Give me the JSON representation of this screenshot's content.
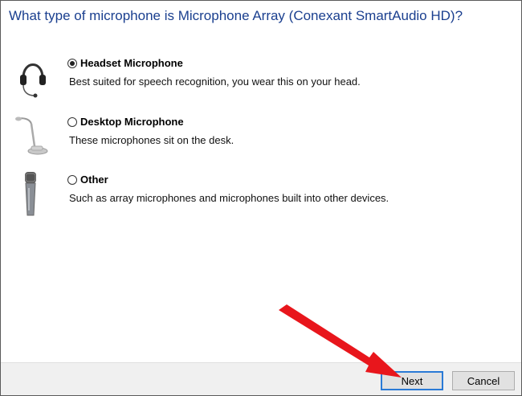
{
  "dialog": {
    "title": "What type of microphone is Microphone Array (Conexant SmartAudio HD)?"
  },
  "options": [
    {
      "label": "Headset Microphone",
      "description": "Best suited for speech recognition, you wear this on your head.",
      "selected": true,
      "icon": "headset-icon"
    },
    {
      "label": "Desktop Microphone",
      "description": "These microphones sit on the desk.",
      "selected": false,
      "icon": "desktop-microphone-icon"
    },
    {
      "label": "Other",
      "description": "Such as array microphones and microphones built into other devices.",
      "selected": false,
      "icon": "handheld-microphone-icon"
    }
  ],
  "buttons": {
    "next_label": "Next",
    "cancel_label": "Cancel"
  },
  "colors": {
    "title": "#1a3f8f",
    "annotation_arrow": "#e8161c",
    "default_button_border": "#2a7ad6"
  }
}
